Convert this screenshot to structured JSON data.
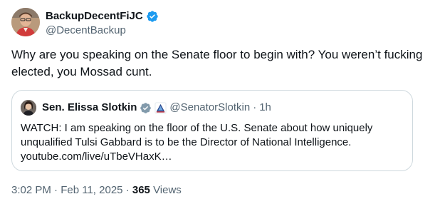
{
  "author": {
    "name": "BackupDecentFiJC",
    "handle": "@DecentBackup",
    "verified_color": "#1d9bf0"
  },
  "tweet": {
    "text": "Why are you speaking on the Senate floor to begin with? You weren’t fucking elected, you Mossad cunt."
  },
  "quote": {
    "name": "Sen. Elissa Slotkin",
    "handle": "@SenatorSlotkin",
    "separator": "·",
    "time": "1h",
    "badge_color": "#829aab",
    "text": "WATCH: I am speaking on the floor of the U.S. Senate about how uniquely unqualified Tulsi Gabbard is to be the Director of National Intelligence.",
    "link": "youtube.com/live/uTbeVHaxK…"
  },
  "meta": {
    "time": "3:02 PM",
    "separator1": "·",
    "date": "Feb 11, 2025",
    "separator2": "·",
    "views_count": "365",
    "views_label": "Views"
  },
  "colors": {
    "text_primary": "#0f1419",
    "text_secondary": "#536471",
    "border": "#cfd9de"
  }
}
